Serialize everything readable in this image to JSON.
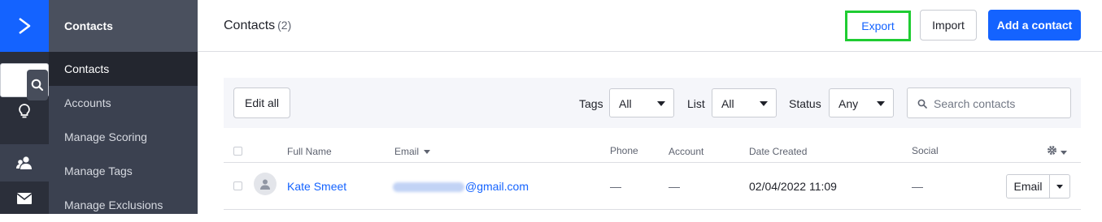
{
  "colors": {
    "brand": "#1463ff",
    "export_highlight": "#1fcc32",
    "rail": "#2b2f3a",
    "subnav": "#3b4150"
  },
  "sidebar": {
    "title": "Contacts",
    "items": [
      {
        "label": "Contacts",
        "active": true
      },
      {
        "label": "Accounts"
      },
      {
        "label": "Manage Scoring"
      },
      {
        "label": "Manage Tags"
      },
      {
        "label": "Manage Exclusions"
      }
    ],
    "rail_icons": [
      "logo-chevron-icon",
      "search-icon",
      "lightbulb-icon",
      "contacts-icon",
      "mail-icon"
    ]
  },
  "header": {
    "title": "Contacts",
    "count": "(2)",
    "export_label": "Export",
    "import_label": "Import",
    "add_label": "Add a contact"
  },
  "filters": {
    "edit_all": "Edit all",
    "tags_label": "Tags",
    "tags_value": "All",
    "list_label": "List",
    "list_value": "All",
    "status_label": "Status",
    "status_value": "Any",
    "search_placeholder": "Search contacts"
  },
  "table": {
    "headers": {
      "full_name": "Full Name",
      "email": "Email",
      "phone": "Phone",
      "account": "Account",
      "date_created": "Date Created",
      "social": "Social"
    },
    "rows": [
      {
        "name": "Kate Smeet",
        "email_domain": "@gmail.com",
        "phone": "—",
        "account": "—",
        "date_created": "02/04/2022 11:09",
        "social": "—",
        "action": "Email"
      }
    ]
  }
}
